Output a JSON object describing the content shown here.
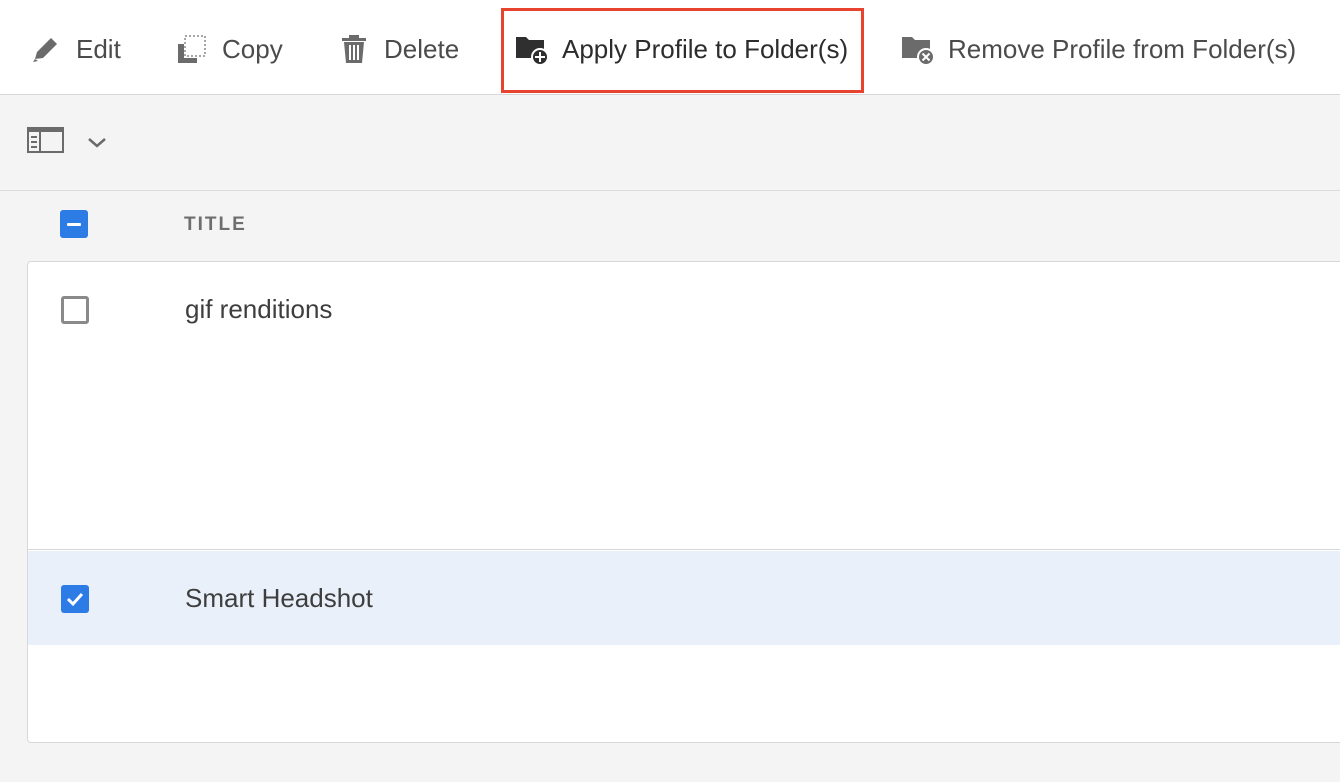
{
  "toolbar": {
    "actions": [
      {
        "label": "Edit",
        "icon": "pencil-icon"
      },
      {
        "label": "Copy",
        "icon": "copy-icon"
      },
      {
        "label": "Delete",
        "icon": "trash-icon"
      },
      {
        "label": "Apply Profile to Folder(s)",
        "icon": "folder-add-icon",
        "highlighted": true
      },
      {
        "label": "Remove Profile from Folder(s)",
        "icon": "folder-remove-icon"
      }
    ]
  },
  "view_switcher": {
    "icon": "list-view-icon",
    "dropdown_icon": "chevron-down-icon"
  },
  "table": {
    "header": {
      "title": "TITLE",
      "select_all_state": "indeterminate"
    },
    "rows": [
      {
        "title": "gif renditions",
        "checked": false
      },
      {
        "title": "Smart Headshot",
        "checked": true
      }
    ]
  },
  "colors": {
    "accent": "#2d7be5",
    "highlight_border": "#e8432f",
    "selected_row": "#e9f0fa"
  }
}
